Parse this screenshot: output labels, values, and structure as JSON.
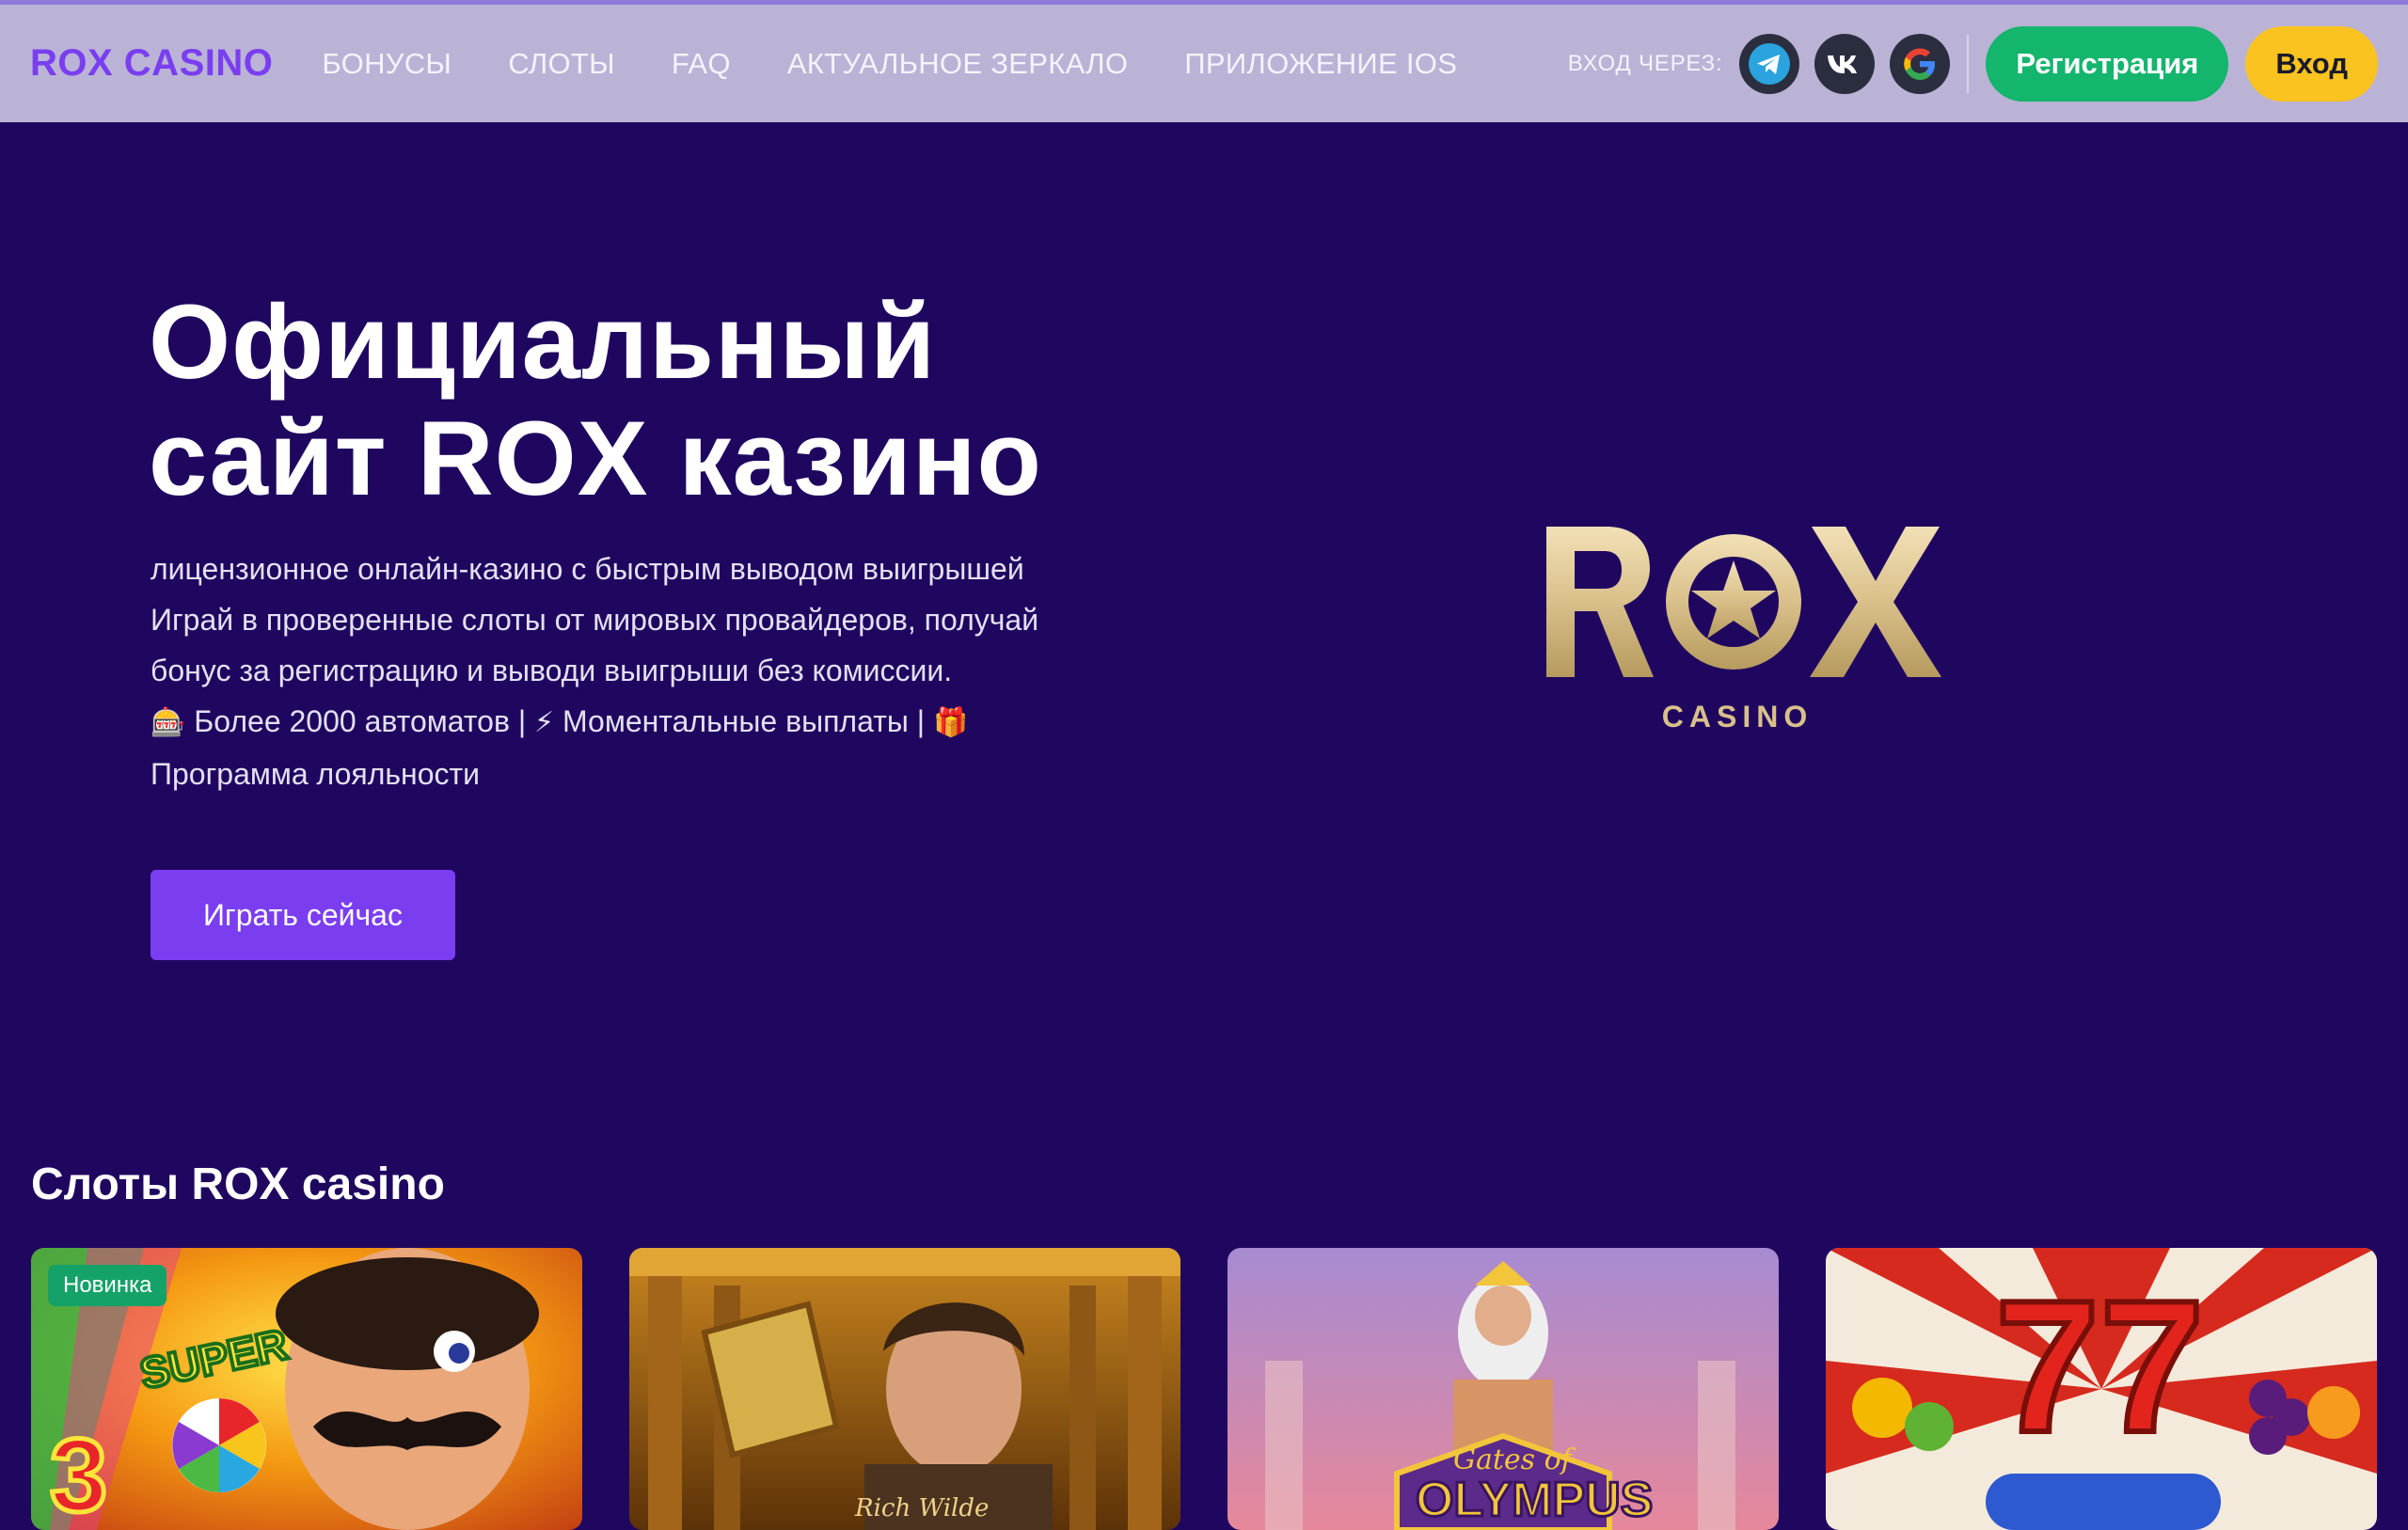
{
  "header": {
    "logo": "ROX CASINO",
    "nav": [
      {
        "label": "БОНУСЫ"
      },
      {
        "label": "СЛОТЫ"
      },
      {
        "label": "FAQ"
      },
      {
        "label": "АКТУАЛЬНОЕ ЗЕРКАЛО"
      },
      {
        "label": "ПРИЛОЖЕНИЕ IOS"
      }
    ],
    "login_via": "ВХОД ЧЕРЕЗ:",
    "social": [
      {
        "icon": "telegram-icon"
      },
      {
        "icon": "vk-icon"
      },
      {
        "icon": "google-icon"
      }
    ],
    "register_label": "Регистрация",
    "login_label": "Вход"
  },
  "hero": {
    "title_line1": "Официальный",
    "title_line2": "сайт ROX казино",
    "desc_line1": "лицензионное онлайн-казино с быстрым выводом выигрышей",
    "desc_line2": "Играй в проверенные слоты от мировых провайдеров, получай",
    "desc_line3": "бонус за регистрацию и выводи выигрыши без комиссии.",
    "feature1": "Более 2000 автоматов |",
    "feature2": "Моментальные выплаты |",
    "feature3": "Программа лояльности",
    "emoji_slot": "🎰",
    "emoji_bolt": "⚡",
    "emoji_gift": "🎁",
    "play_label": "Играть сейчас",
    "brand_logo_text": "ROX",
    "brand_logo_sub": "CASINO"
  },
  "slots": {
    "title": "Слоты ROX casino",
    "items": [
      {
        "image": "super-3-hot-chillies-slot-image",
        "badge": "Новинка"
      },
      {
        "image": "book-of-dead-slot-image"
      },
      {
        "image": "gates-of-olympus-slot-image"
      },
      {
        "image": "777-fruit-slot-image"
      }
    ]
  },
  "colors": {
    "background": "#1f0760",
    "header": "#bab3d6",
    "accent": "#7a3ef0",
    "register": "#14b56d",
    "login": "#fbc31f",
    "badge": "#15a268"
  }
}
